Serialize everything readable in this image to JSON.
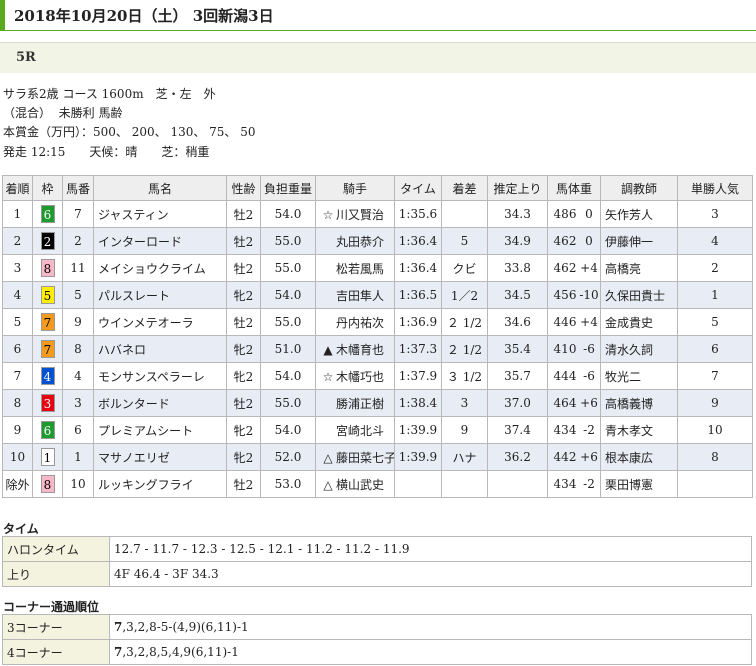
{
  "page_title": "2018年10月20日（土） 3回新潟3日",
  "race_number": "5R",
  "info_lines": [
    "サラ系2歳 コース 1600m　芝・左　外",
    "（混合）  未勝利 馬齢",
    "本賞金（万円）：500、 200、 130、 75、 50",
    "発走 12:15　　天候：晴　　芝：稍重"
  ],
  "colors": {
    "title_accent": "#5aa91f",
    "waku": {
      "1": {
        "bg": "#ffffff",
        "fg": "#000000"
      },
      "2": {
        "bg": "#000000",
        "fg": "#ffffff"
      },
      "3": {
        "bg": "#e60012",
        "fg": "#ffffff"
      },
      "4": {
        "bg": "#0050d0",
        "fg": "#ffffff"
      },
      "5": {
        "bg": "#ffee00",
        "fg": "#000000"
      },
      "6": {
        "bg": "#1e9a2e",
        "fg": "#ffffff"
      },
      "7": {
        "bg": "#f39a1f",
        "fg": "#000000"
      },
      "8": {
        "bg": "#f7b8c8",
        "fg": "#000000"
      }
    }
  },
  "table": {
    "headers": [
      "着順",
      "枠",
      "馬番",
      "馬名",
      "性齢",
      "負担重量",
      "騎手",
      "タイム",
      "着差",
      "推定上り",
      "馬体重",
      "調教師",
      "単勝人気"
    ],
    "rows": [
      {
        "pos": "1",
        "waku": "6",
        "num": "7",
        "horse": "ジャスティン",
        "sex_age": "牡2",
        "weight": "54.0",
        "mark": "☆",
        "jockey": "川又賢治",
        "time": "1:35.6",
        "margin": "",
        "last3f": "34.3",
        "bw": "486",
        "bw_diff": "0",
        "trainer": "矢作芳人",
        "pop": "3"
      },
      {
        "pos": "2",
        "waku": "2",
        "num": "2",
        "horse": "インターロード",
        "sex_age": "牡2",
        "weight": "55.0",
        "mark": "",
        "jockey": "丸田恭介",
        "time": "1:36.4",
        "margin": "5",
        "last3f": "34.9",
        "bw": "462",
        "bw_diff": "0",
        "trainer": "伊藤伸一",
        "pop": "4"
      },
      {
        "pos": "3",
        "waku": "8",
        "num": "11",
        "horse": "メイショウクライム",
        "sex_age": "牡2",
        "weight": "55.0",
        "mark": "",
        "jockey": "松若風馬",
        "time": "1:36.4",
        "margin": "クビ",
        "last3f": "33.8",
        "bw": "462",
        "bw_diff": "+4",
        "trainer": "高橋亮",
        "pop": "2"
      },
      {
        "pos": "4",
        "waku": "5",
        "num": "5",
        "horse": "パルスレート",
        "sex_age": "牝2",
        "weight": "54.0",
        "mark": "",
        "jockey": "吉田隼人",
        "time": "1:36.5",
        "margin": "1／2",
        "last3f": "34.5",
        "bw": "456",
        "bw_diff": "-10",
        "trainer": "久保田貴士",
        "pop": "1"
      },
      {
        "pos": "5",
        "waku": "7",
        "num": "9",
        "horse": "ウインメテオーラ",
        "sex_age": "牡2",
        "weight": "55.0",
        "mark": "",
        "jockey": "丹内祐次",
        "time": "1:36.9",
        "margin": "２ 1/2",
        "last3f": "34.6",
        "bw": "446",
        "bw_diff": "+4",
        "trainer": "金成貴史",
        "pop": "5"
      },
      {
        "pos": "6",
        "waku": "7",
        "num": "8",
        "horse": "ハバネロ",
        "sex_age": "牝2",
        "weight": "51.0",
        "mark": "▲",
        "jockey": "木幡育也",
        "time": "1:37.3",
        "margin": "２ 1/2",
        "last3f": "35.4",
        "bw": "410",
        "bw_diff": "-6",
        "trainer": "清水久詞",
        "pop": "6"
      },
      {
        "pos": "7",
        "waku": "4",
        "num": "4",
        "horse": "モンサンスペラーレ",
        "sex_age": "牝2",
        "weight": "54.0",
        "mark": "☆",
        "jockey": "木幡巧也",
        "time": "1:37.9",
        "margin": "３ 1/2",
        "last3f": "35.7",
        "bw": "444",
        "bw_diff": "-6",
        "trainer": "牧光二",
        "pop": "7"
      },
      {
        "pos": "8",
        "waku": "3",
        "num": "3",
        "horse": "ボルンタード",
        "sex_age": "牡2",
        "weight": "55.0",
        "mark": "",
        "jockey": "勝浦正樹",
        "time": "1:38.4",
        "margin": "3",
        "last3f": "37.0",
        "bw": "464",
        "bw_diff": "+6",
        "trainer": "高橋義博",
        "pop": "9"
      },
      {
        "pos": "9",
        "waku": "6",
        "num": "6",
        "horse": "プレミアムシート",
        "sex_age": "牝2",
        "weight": "54.0",
        "mark": "",
        "jockey": "宮崎北斗",
        "time": "1:39.9",
        "margin": "9",
        "last3f": "37.4",
        "bw": "434",
        "bw_diff": "-2",
        "trainer": "青木孝文",
        "pop": "10"
      },
      {
        "pos": "10",
        "waku": "1",
        "num": "1",
        "horse": "マサノエリゼ",
        "sex_age": "牝2",
        "weight": "52.0",
        "mark": "△",
        "jockey": "藤田菜七子",
        "time": "1:39.9",
        "margin": "ハナ",
        "last3f": "36.2",
        "bw": "442",
        "bw_diff": "+6",
        "trainer": "根本康広",
        "pop": "8"
      },
      {
        "pos": "除外",
        "waku": "8",
        "num": "10",
        "horse": "ルッキングフライ",
        "sex_age": "牡2",
        "weight": "53.0",
        "mark": "△",
        "jockey": "横山武史",
        "time": "",
        "margin": "",
        "last3f": "",
        "bw": "434",
        "bw_diff": "-2",
        "trainer": "栗田博憲",
        "pop": ""
      }
    ]
  },
  "time_section": {
    "title": "タイム",
    "rows": [
      {
        "label": "ハロンタイム",
        "value": "12.7 - 11.7 - 12.3 - 12.5 - 12.1 - 11.2 - 11.2 - 11.9"
      },
      {
        "label": "上り",
        "value": "4F 46.4 - 3F 34.3"
      }
    ]
  },
  "corner_section": {
    "title": "コーナー通過順位",
    "rows": [
      {
        "label": "3コーナー",
        "lead": "7",
        "rest": ",3,2,8-5-(4,9)(6,11)-1"
      },
      {
        "label": "4コーナー",
        "lead": "7",
        "rest": ",3,2,8,5,4,9(6,11)-1"
      }
    ]
  }
}
